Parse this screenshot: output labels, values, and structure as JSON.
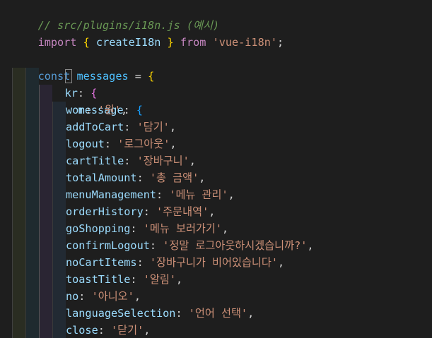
{
  "editor": {
    "comment": "// src/plugins/i18n.js (예시)",
    "import_line": {
      "kw_import": "import",
      "brace_open": "{",
      "fn_name": "createI18n",
      "brace_close": "}",
      "kw_from": "from",
      "module": "'vue-i18n'",
      "semicolon": ";"
    },
    "const_line": {
      "kw_const": "const",
      "var_name": "messages",
      "equals": "=",
      "brace": "{"
    },
    "kr_line": {
      "key": "kr",
      "colon": ":",
      "brace": "{"
    },
    "message_line": {
      "key": "message",
      "colon": ":",
      "brace": "{"
    },
    "entries": [
      {
        "key": "won",
        "value": "'원'"
      },
      {
        "key": "addToCart",
        "value": "'담기'"
      },
      {
        "key": "logout",
        "value": "'로그아웃'"
      },
      {
        "key": "cartTitle",
        "value": "'장바구니'"
      },
      {
        "key": "totalAmount",
        "value": "'총 금액'"
      },
      {
        "key": "menuManagement",
        "value": "'메뉴 관리'"
      },
      {
        "key": "orderHistory",
        "value": "'주문내역'"
      },
      {
        "key": "goShopping",
        "value": "'메뉴 보러가기'"
      },
      {
        "key": "confirmLogout",
        "value": "'정말 로그아웃하시겠습니까?'"
      },
      {
        "key": "noCartItems",
        "value": "'장바구니가 비어있습니다'"
      },
      {
        "key": "toastTitle",
        "value": "'알림'"
      },
      {
        "key": "no",
        "value": "'아니오'"
      },
      {
        "key": "languageSelection",
        "value": "'언어 선택'"
      },
      {
        "key": "close",
        "value": "'닫기'"
      }
    ],
    "colors": {
      "background": "#1e1e1e",
      "comment": "#6a9955",
      "keyword_control": "#c586c0",
      "keyword": "#569cd6",
      "variable": "#9cdcfe",
      "string": "#ce9178",
      "bracket_level1": "#ffd700",
      "bracket_level2": "#da70d6",
      "bracket_level3": "#179fff"
    }
  }
}
